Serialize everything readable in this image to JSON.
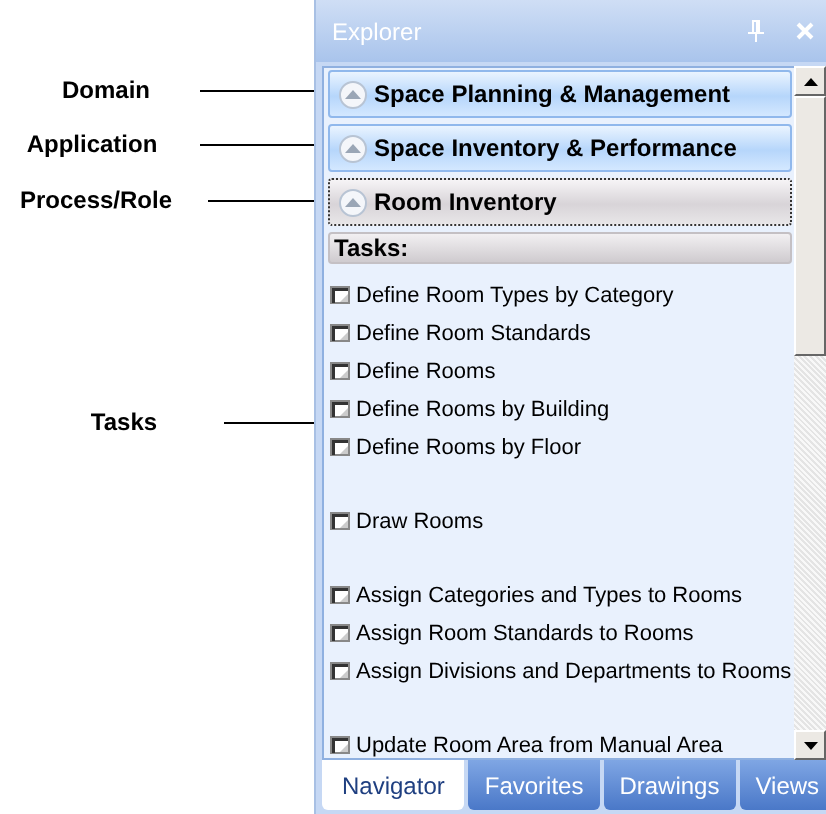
{
  "callouts": [
    {
      "label": "Domain"
    },
    {
      "label": "Application"
    },
    {
      "label": "Process/Role"
    },
    {
      "label": "Tasks"
    }
  ],
  "window": {
    "title": "Explorer"
  },
  "headers": [
    {
      "kind": "domain",
      "label": "Space Planning & Management",
      "expanded": true
    },
    {
      "kind": "application",
      "label": "Space Inventory & Performance",
      "expanded": true
    },
    {
      "kind": "process",
      "label": "Room Inventory",
      "expanded": true
    }
  ],
  "tasks_header": "Tasks:",
  "task_groups": [
    [
      "Define Room Types by Category",
      "Define Room Standards",
      "Define Rooms",
      "Define Rooms by Building",
      "Define Rooms by Floor"
    ],
    [
      "Draw Rooms"
    ],
    [
      "Assign Categories and Types to Rooms",
      "Assign Room Standards to Rooms",
      "Assign Divisions and Departments to Rooms"
    ],
    [
      "Update Room Area from Manual Area"
    ]
  ],
  "tabs": [
    {
      "label": "Navigator",
      "selected": true
    },
    {
      "label": "Favorites",
      "selected": false
    },
    {
      "label": "Drawings",
      "selected": false
    },
    {
      "label": "Views",
      "selected": false
    }
  ]
}
